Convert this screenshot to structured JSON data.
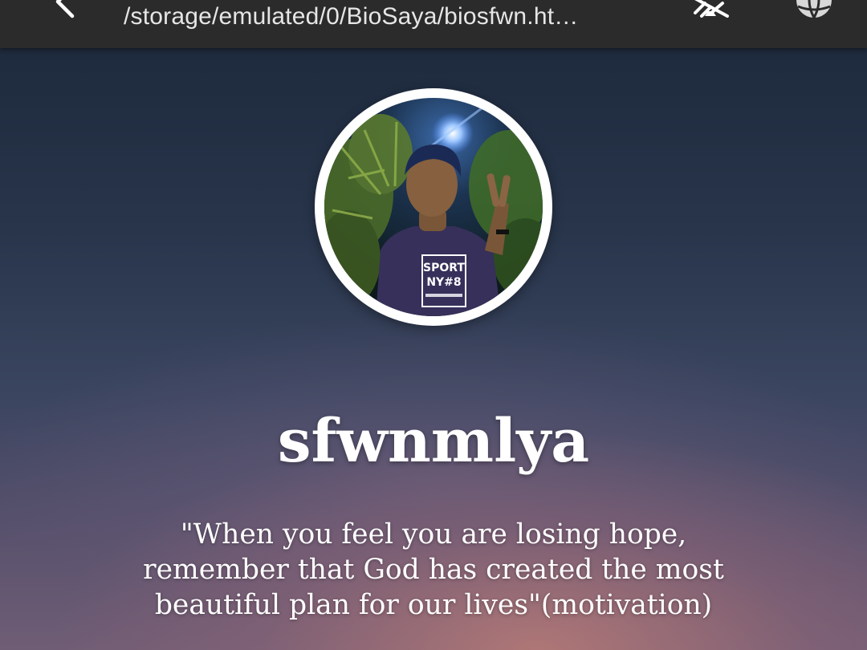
{
  "browser": {
    "url": "/storage/emulated/0/BioSaya/biosfwn.ht…",
    "back_icon": "chevron-left-icon",
    "icons": [
      "no-signal-satellite-icon",
      "globe-icon"
    ]
  },
  "profile": {
    "avatar": "profile-photo",
    "name": "sfwnmlya",
    "quote_lines": [
      "\"When you feel you are losing hope,",
      "remember that God has created the most",
      "beautiful plan for our lives\"(motivation)"
    ],
    "shirt_text": [
      "SPORT",
      "NY#8"
    ]
  },
  "colors": {
    "toolbar": "#2b2b2b",
    "text": "#ffffff"
  }
}
